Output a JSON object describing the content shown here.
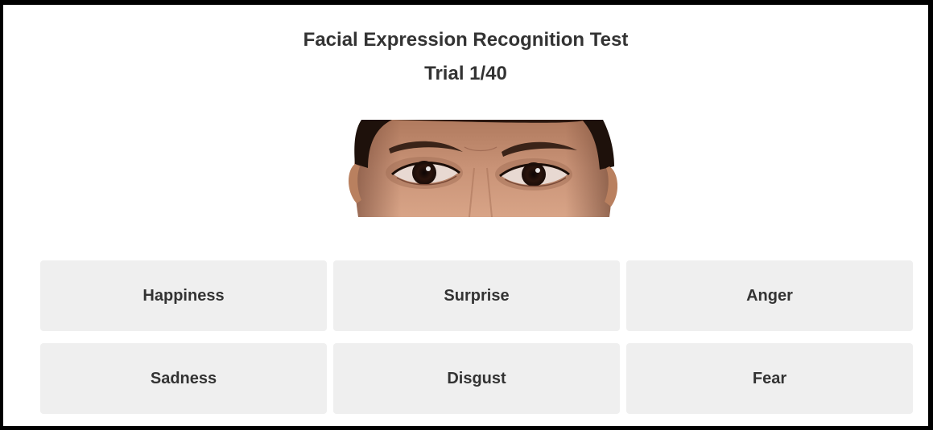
{
  "header": {
    "title": "Facial Expression Recognition Test",
    "trial": "Trial 1/40"
  },
  "stimulus": {
    "alt": "Cropped photo of a woman's eyes and brows"
  },
  "choices": [
    {
      "label": "Happiness"
    },
    {
      "label": "Surprise"
    },
    {
      "label": "Anger"
    },
    {
      "label": "Sadness"
    },
    {
      "label": "Disgust"
    },
    {
      "label": "Fear"
    }
  ],
  "colors": {
    "background": "#ffffff",
    "border": "#000000",
    "button": "#efefef",
    "text": "#333333"
  }
}
